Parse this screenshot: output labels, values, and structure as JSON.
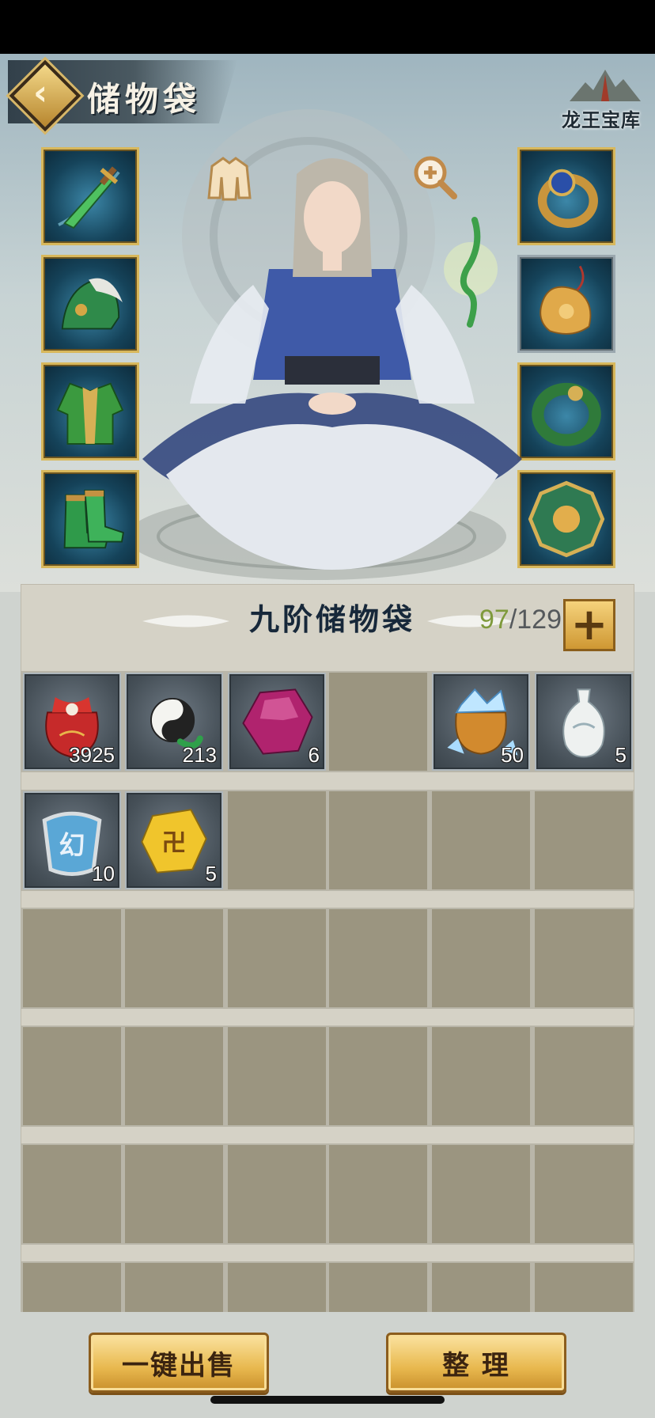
{
  "header": {
    "title": "储物袋",
    "brand": "龙王宝库"
  },
  "equipment": {
    "left": [
      {
        "name": "sword",
        "icon": "jade-sword-icon"
      },
      {
        "name": "helmet",
        "icon": "helmet-icon"
      },
      {
        "name": "robe",
        "icon": "robe-icon"
      },
      {
        "name": "boots",
        "icon": "boots-icon"
      }
    ],
    "right": [
      {
        "name": "ring",
        "icon": "sapphire-ring-icon"
      },
      {
        "name": "pendant",
        "icon": "gold-pendant-icon"
      },
      {
        "name": "bracelet",
        "icon": "jade-bracelet-icon"
      },
      {
        "name": "amulet",
        "icon": "bagua-amulet-icon"
      }
    ]
  },
  "bag": {
    "title": "九阶储物袋",
    "used": "97",
    "capacity": "/129",
    "items": [
      {
        "name": "red-lucky-bag",
        "count": "3925"
      },
      {
        "name": "yin-yang-pendant",
        "count": "213"
      },
      {
        "name": "purple-gem",
        "count": "6"
      },
      {
        "name": "empty",
        "count": ""
      },
      {
        "name": "crystal-bag",
        "count": "50"
      },
      {
        "name": "porcelain-vase",
        "count": "5"
      },
      {
        "name": "illusion-token",
        "count": "10"
      },
      {
        "name": "gold-nugget",
        "count": "5"
      }
    ]
  },
  "actions": {
    "sell_all": "一键出售",
    "sort": "整 理"
  },
  "colors": {
    "gold": "#e8b84e",
    "used_count": "#7f9a3c",
    "slot_border": "#d8b85c"
  }
}
